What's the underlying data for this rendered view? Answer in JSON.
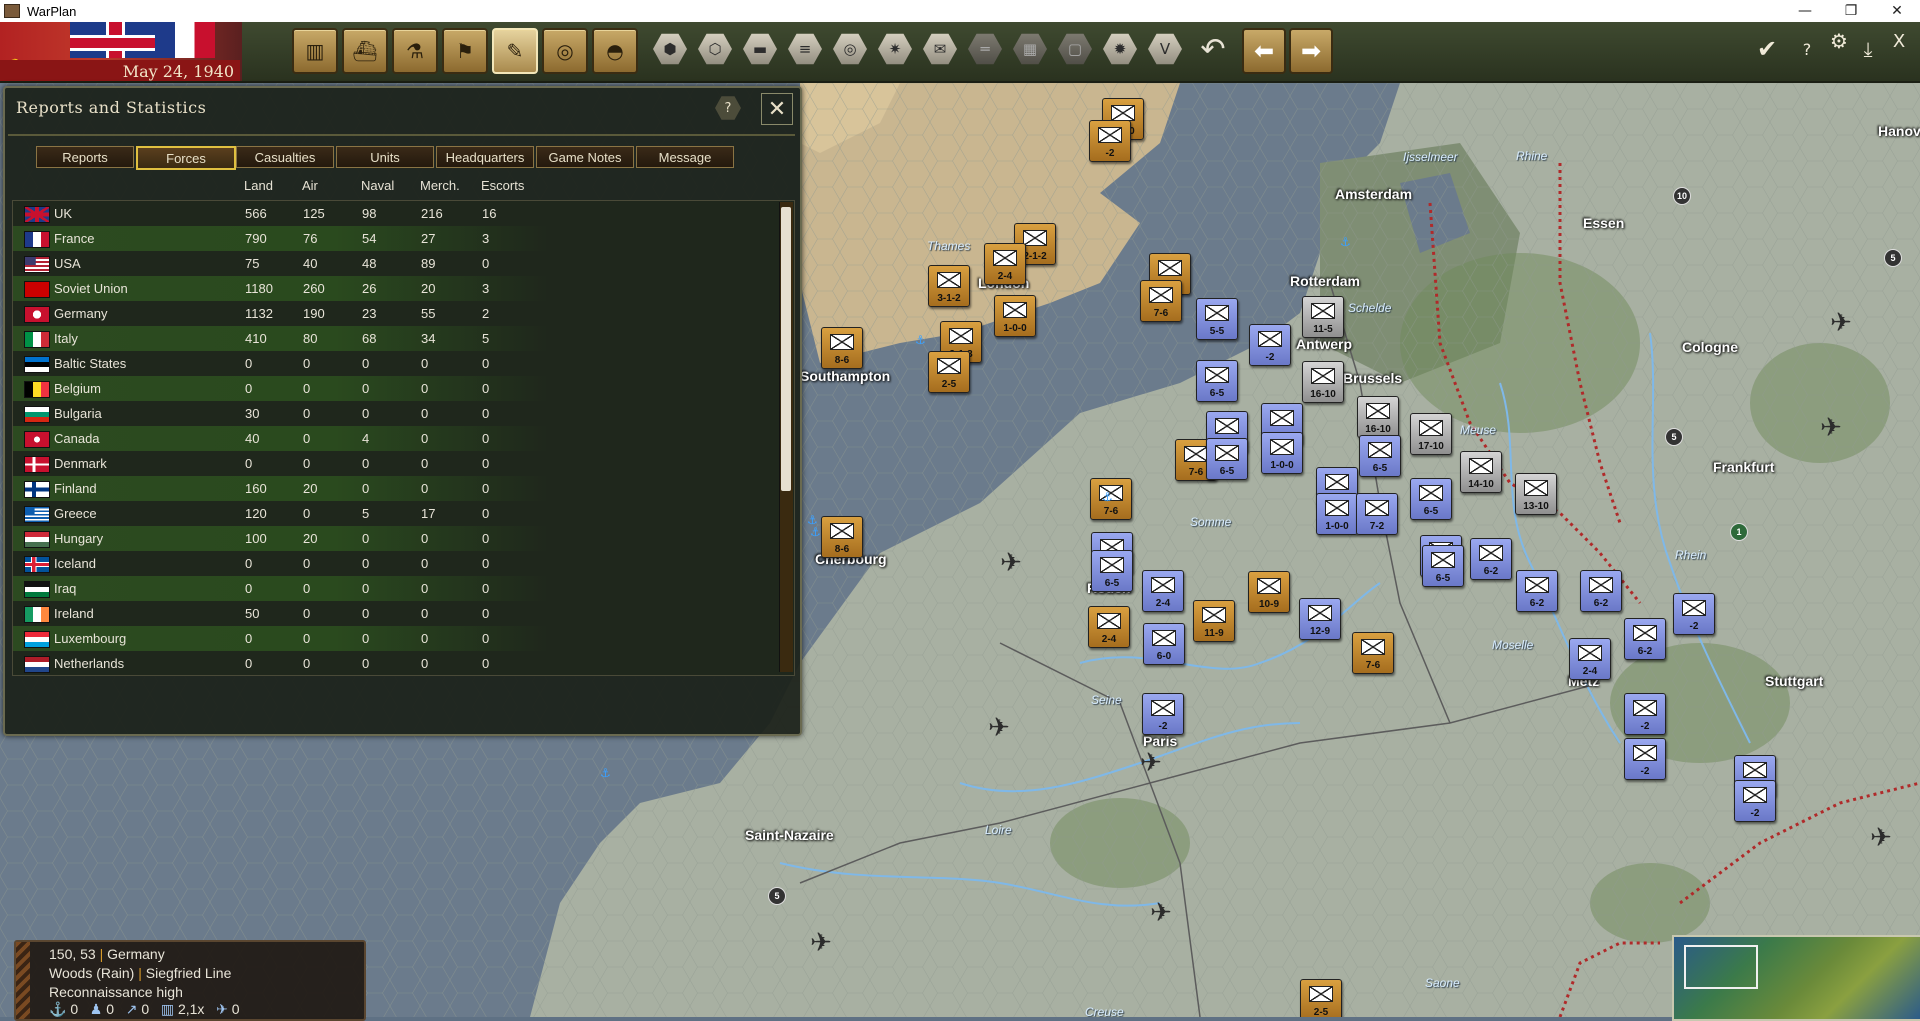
{
  "window": {
    "title": "WarPlan",
    "minimize": "—",
    "restore": "❐",
    "close": "✕"
  },
  "topbar": {
    "date": "May 24, 1940",
    "buttons": [
      {
        "name": "production-button",
        "icon": "factory-icon",
        "glyph": "▥"
      },
      {
        "name": "naval-button",
        "icon": "ship-icon",
        "glyph": "⛴"
      },
      {
        "name": "research-button",
        "icon": "microscope-icon",
        "glyph": "⚗"
      },
      {
        "name": "diplomacy-button",
        "icon": "flag-icon",
        "glyph": "⚑"
      },
      {
        "name": "reports-button",
        "icon": "report-icon",
        "glyph": "✎"
      },
      {
        "name": "recon-button",
        "icon": "binoculars-icon",
        "glyph": "◎"
      },
      {
        "name": "helmet-button",
        "icon": "helmet-icon",
        "glyph": "◓"
      }
    ],
    "hex_buttons": [
      {
        "name": "hex-filter-1",
        "icon": "hex-icon",
        "glyph": "⬢",
        "dim": false
      },
      {
        "name": "hex-filter-2",
        "icon": "hex-cluster-icon",
        "glyph": "⬡",
        "dim": false
      },
      {
        "name": "hex-filter-3",
        "icon": "supply-icon",
        "glyph": "▬",
        "dim": false
      },
      {
        "name": "hex-filter-4",
        "icon": "stack-icon",
        "glyph": "≡",
        "dim": false
      },
      {
        "name": "hex-filter-5",
        "icon": "target-icon",
        "glyph": "◎",
        "dim": false
      },
      {
        "name": "hex-filter-6",
        "icon": "sun-icon",
        "glyph": "✷",
        "dim": false
      },
      {
        "name": "hex-filter-7",
        "icon": "envelope-icon",
        "glyph": "✉",
        "dim": false
      },
      {
        "name": "hex-filter-8",
        "icon": "lines-icon",
        "glyph": "═",
        "dim": true
      },
      {
        "name": "hex-filter-9",
        "icon": "grid-icon",
        "glyph": "▦",
        "dim": true
      },
      {
        "name": "hex-filter-10",
        "icon": "square-icon",
        "glyph": "▢",
        "dim": true
      },
      {
        "name": "hex-filter-11",
        "icon": "explosion-icon",
        "glyph": "✹",
        "dim": false
      },
      {
        "name": "hex-filter-12",
        "icon": "victory-icon",
        "glyph": "V",
        "dim": false
      }
    ],
    "undo_glyph": "↶",
    "prev_glyph": "⬅",
    "next_glyph": "➡",
    "right": {
      "confirm": "✔",
      "help": "?",
      "settings": "⚙",
      "save": "⤓",
      "close": "X"
    }
  },
  "panel": {
    "title": "Reports and Statistics",
    "help": "?",
    "close": "✕",
    "tabs": [
      "Reports",
      "Forces",
      "Casualties",
      "Units",
      "Headquarters",
      "Game Notes",
      "Message"
    ],
    "active_tab": "Forces",
    "columns": [
      "Land",
      "Air",
      "Naval",
      "Merch.",
      "Escorts"
    ],
    "rows": [
      {
        "country": "UK",
        "land": "566",
        "air": "125",
        "naval": "98",
        "merch": "216",
        "escorts": "16",
        "flag": "uk"
      },
      {
        "country": "France",
        "land": "790",
        "air": "76",
        "naval": "54",
        "merch": "27",
        "escorts": "3",
        "flag": "fr"
      },
      {
        "country": "USA",
        "land": "75",
        "air": "40",
        "naval": "48",
        "merch": "89",
        "escorts": "0",
        "flag": "us"
      },
      {
        "country": "Soviet Union",
        "land": "1180",
        "air": "260",
        "naval": "26",
        "merch": "20",
        "escorts": "3",
        "flag": "su"
      },
      {
        "country": "Germany",
        "land": "1132",
        "air": "190",
        "naval": "23",
        "merch": "55",
        "escorts": "2",
        "flag": "de"
      },
      {
        "country": "Italy",
        "land": "410",
        "air": "80",
        "naval": "68",
        "merch": "34",
        "escorts": "5",
        "flag": "it"
      },
      {
        "country": "Baltic States",
        "land": "0",
        "air": "0",
        "naval": "0",
        "merch": "0",
        "escorts": "0",
        "flag": "ee"
      },
      {
        "country": "Belgium",
        "land": "0",
        "air": "0",
        "naval": "0",
        "merch": "0",
        "escorts": "0",
        "flag": "be"
      },
      {
        "country": "Bulgaria",
        "land": "30",
        "air": "0",
        "naval": "0",
        "merch": "0",
        "escorts": "0",
        "flag": "bg"
      },
      {
        "country": "Canada",
        "land": "40",
        "air": "0",
        "naval": "4",
        "merch": "0",
        "escorts": "0",
        "flag": "ca"
      },
      {
        "country": "Denmark",
        "land": "0",
        "air": "0",
        "naval": "0",
        "merch": "0",
        "escorts": "0",
        "flag": "dk"
      },
      {
        "country": "Finland",
        "land": "160",
        "air": "20",
        "naval": "0",
        "merch": "0",
        "escorts": "0",
        "flag": "fi"
      },
      {
        "country": "Greece",
        "land": "120",
        "air": "0",
        "naval": "5",
        "merch": "17",
        "escorts": "0",
        "flag": "gr"
      },
      {
        "country": "Hungary",
        "land": "100",
        "air": "20",
        "naval": "0",
        "merch": "0",
        "escorts": "0",
        "flag": "hu"
      },
      {
        "country": "Iceland",
        "land": "0",
        "air": "0",
        "naval": "0",
        "merch": "0",
        "escorts": "0",
        "flag": "is"
      },
      {
        "country": "Iraq",
        "land": "0",
        "air": "0",
        "naval": "0",
        "merch": "0",
        "escorts": "0",
        "flag": "iq"
      },
      {
        "country": "Ireland",
        "land": "50",
        "air": "0",
        "naval": "0",
        "merch": "0",
        "escorts": "0",
        "flag": "ie"
      },
      {
        "country": "Luxembourg",
        "land": "0",
        "air": "0",
        "naval": "0",
        "merch": "0",
        "escorts": "0",
        "flag": "lu"
      },
      {
        "country": "Netherlands",
        "land": "0",
        "air": "0",
        "naval": "0",
        "merch": "0",
        "escorts": "0",
        "flag": "nl"
      }
    ]
  },
  "map": {
    "cities": [
      "London",
      "Southampton",
      "Cherbourg",
      "Rouen",
      "Paris",
      "Saint-Nazaire",
      "Amsterdam",
      "Rotterdam",
      "Antwerp",
      "Brussels",
      "Essen",
      "Cologne",
      "Frankfurt",
      "Metz",
      "Stuttgart",
      "Hanover"
    ],
    "rivers": [
      "Thames",
      "Somme",
      "Seine",
      "Loire",
      "Meuse",
      "Moselle",
      "Rhine",
      "Schelde",
      "Saone",
      "Creuse",
      "Rhein",
      "Ijsselmeer"
    ],
    "sea_color": "#6b7b8c",
    "land_color": "#a8b0a2",
    "uk_land_color": "#c9b690"
  },
  "counters": [
    {
      "label": "1-0-0",
      "type": "brit"
    },
    {
      "label": "-2",
      "type": "brit"
    },
    {
      "label": "2-1-2",
      "type": "brit"
    },
    {
      "label": "2-4",
      "type": "brit"
    },
    {
      "label": "3-1-2",
      "type": "brit"
    },
    {
      "label": "1-0-0",
      "type": "brit"
    },
    {
      "label": "8-6",
      "type": "brit"
    },
    {
      "label": "3-1-3",
      "type": "brit"
    },
    {
      "label": "2-5",
      "type": "brit"
    },
    {
      "label": "1-0-0",
      "type": "brit"
    },
    {
      "label": "7-6",
      "type": "brit"
    },
    {
      "label": "7-6",
      "type": "brit"
    },
    {
      "label": "8-6",
      "type": "brit"
    },
    {
      "label": "2-1-2",
      "type": "fr"
    },
    {
      "label": "6-5",
      "type": "fr"
    },
    {
      "label": "7-6",
      "type": "brit"
    },
    {
      "label": "2-4",
      "type": "brit"
    },
    {
      "label": "2-4",
      "type": "fr"
    },
    {
      "label": "11-9",
      "type": "brit"
    },
    {
      "label": "10-9",
      "type": "brit"
    },
    {
      "label": "12-9",
      "type": "fr"
    },
    {
      "label": "6-0",
      "type": "fr"
    },
    {
      "label": "-2",
      "type": "fr"
    },
    {
      "label": "7-6",
      "type": "brit"
    },
    {
      "label": "5-5",
      "type": "fr"
    },
    {
      "label": "6-5",
      "type": "fr"
    },
    {
      "label": "-2",
      "type": "fr"
    },
    {
      "label": "11-5",
      "type": "ger"
    },
    {
      "label": "16-10",
      "type": "ger"
    },
    {
      "label": "16-10",
      "type": "ger"
    },
    {
      "label": "17-10",
      "type": "ger"
    },
    {
      "label": "14-10",
      "type": "ger"
    },
    {
      "label": "13-10",
      "type": "ger"
    },
    {
      "label": "1-1-0",
      "type": "fr"
    },
    {
      "label": "6-5",
      "type": "fr"
    },
    {
      "label": "7-2",
      "type": "fr"
    },
    {
      "label": "1-0-0",
      "type": "fr"
    },
    {
      "label": "6-5",
      "type": "fr"
    },
    {
      "label": "1-0-0",
      "type": "fr"
    },
    {
      "label": "6-5",
      "type": "fr"
    },
    {
      "label": "7-2",
      "type": "fr"
    },
    {
      "label": "6-5",
      "type": "fr"
    },
    {
      "label": "6-5",
      "type": "fr"
    },
    {
      "label": "6-5",
      "type": "fr"
    },
    {
      "label": "6-2",
      "type": "fr"
    },
    {
      "label": "6-2",
      "type": "fr"
    },
    {
      "label": "6-2",
      "type": "fr"
    },
    {
      "label": "6-2",
      "type": "fr"
    },
    {
      "label": "2-4",
      "type": "fr"
    },
    {
      "label": "-2",
      "type": "fr"
    },
    {
      "label": "-2",
      "type": "fr"
    },
    {
      "label": "-2",
      "type": "fr"
    },
    {
      "label": "-2",
      "type": "fr"
    },
    {
      "label": "-2",
      "type": "fr"
    },
    {
      "label": "2-5",
      "type": "brit"
    }
  ],
  "info": {
    "line1_coords": "150, 53",
    "line1_country": "Germany",
    "line2_terrain": "Woods (Rain)",
    "line2_feature": "Siegfried Line",
    "line3": "Reconnaissance high",
    "stats": [
      "0",
      "0",
      "0",
      "2,1x",
      "0"
    ],
    "stat_icons": [
      "anchor-icon",
      "soldier-icon",
      "artillery-icon",
      "fort-icon",
      "plane-icon"
    ]
  }
}
